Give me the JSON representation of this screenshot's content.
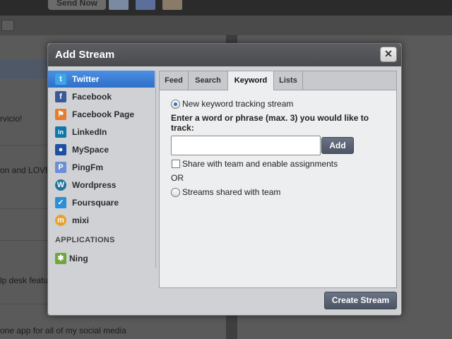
{
  "background": {
    "send_label": "Send Now",
    "lines": [
      "rvicio!",
      "on and LOVE",
      "lp desk featu",
      "one app for all of my social media"
    ]
  },
  "modal": {
    "title": "Add Stream",
    "close_label": "✕"
  },
  "sidebar": {
    "items": [
      {
        "label": "Twitter",
        "icon": "twitter-icon",
        "color": "#3ba6e8",
        "glyph": "t",
        "active": true
      },
      {
        "label": "Facebook",
        "icon": "facebook-icon",
        "color": "#3b5998",
        "glyph": "f"
      },
      {
        "label": "Facebook Page",
        "icon": "facebook-page-icon",
        "color": "#e87b2c",
        "glyph": "⚑"
      },
      {
        "label": "LinkedIn",
        "icon": "linkedin-icon",
        "color": "#0e76a8",
        "glyph": "in"
      },
      {
        "label": "MySpace",
        "icon": "myspace-icon",
        "color": "#1d4fa3",
        "glyph": "●"
      },
      {
        "label": "PingFm",
        "icon": "pingfm-icon",
        "color": "#6b8fd4",
        "glyph": "P"
      },
      {
        "label": "Wordpress",
        "icon": "wordpress-icon",
        "color": "#21759b",
        "glyph": "W"
      },
      {
        "label": "Foursquare",
        "icon": "foursquare-icon",
        "color": "#2b8fd6",
        "glyph": "✓"
      },
      {
        "label": "mixi",
        "icon": "mixi-icon",
        "color": "#e8a22c",
        "glyph": "m"
      }
    ],
    "section_title": "APPLICATIONS",
    "apps": [
      {
        "label": "Ning",
        "icon": "ning-icon",
        "color": "#6ea83a",
        "glyph": "✱"
      }
    ]
  },
  "tabs": [
    {
      "label": "Feed"
    },
    {
      "label": "Search"
    },
    {
      "label": "Keyword",
      "active": true
    },
    {
      "label": "Lists"
    }
  ],
  "keyword": {
    "new_stream_label": "New keyword tracking stream",
    "prompt": "Enter a word or phrase (max. 3) you would like to track:",
    "input_value": "",
    "add_label": "Add",
    "share_label": "Share with team and enable assignments",
    "or_label": "OR",
    "shared_label": "Streams shared with team"
  },
  "footer": {
    "create_label": "Create Stream"
  }
}
